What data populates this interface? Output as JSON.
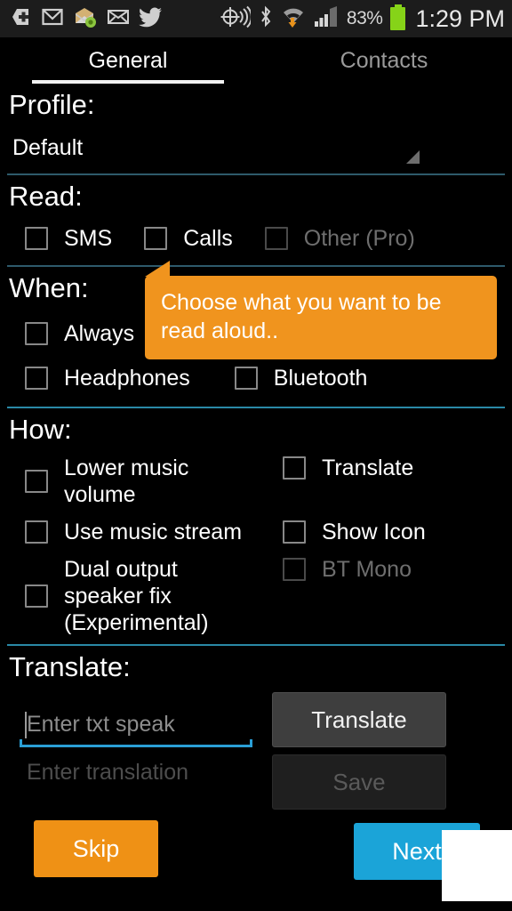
{
  "status_bar": {
    "notification_icons": [
      "add-plus-icon",
      "gmail-icon",
      "mail-badge-icon",
      "envelope-icon",
      "twitter-icon"
    ],
    "system_icons": [
      "location-gps-icon",
      "bluetooth-icon",
      "wifi-download-icon",
      "signal-bars-icon"
    ],
    "battery_percent": "83%",
    "battery_icon": "battery-full-icon",
    "clock": "1:29 PM"
  },
  "tabs": [
    {
      "label": "General",
      "active": true
    },
    {
      "label": "Contacts",
      "active": false
    }
  ],
  "sections": {
    "profile": {
      "title": "Profile:",
      "selected": "Default"
    },
    "read": {
      "title": "Read:",
      "items": [
        {
          "label": "SMS",
          "checked": false,
          "disabled": false
        },
        {
          "label": "Calls",
          "checked": false,
          "disabled": false
        },
        {
          "label": "Other (Pro)",
          "checked": false,
          "disabled": true
        }
      ]
    },
    "when": {
      "title": "When:",
      "items": [
        {
          "label": "Always",
          "checked": false,
          "disabled": false
        },
        {
          "label": "Headphones",
          "checked": false,
          "disabled": false
        },
        {
          "label": "Bluetooth",
          "checked": false,
          "disabled": false
        }
      ]
    },
    "how": {
      "title": "How:",
      "items": [
        {
          "label": "Lower music volume",
          "checked": false,
          "disabled": false
        },
        {
          "label": "Translate",
          "checked": false,
          "disabled": false
        },
        {
          "label": "Use music stream",
          "checked": false,
          "disabled": false
        },
        {
          "label": "Show Icon",
          "checked": false,
          "disabled": false
        },
        {
          "label": "Dual output speaker fix (Experimental)",
          "checked": false,
          "disabled": false
        },
        {
          "label": "BT Mono",
          "checked": false,
          "disabled": true
        }
      ]
    },
    "translate": {
      "title": "Translate:",
      "input_placeholder": "Enter txt speak",
      "input_value": "",
      "translate_button": "Translate",
      "translation_placeholder": "Enter translation",
      "translation_value": "",
      "save_button": "Save"
    }
  },
  "tooltip": {
    "text": "Choose what you want to be read aloud.."
  },
  "wizard": {
    "skip_label": "Skip",
    "next_label": "Next"
  },
  "colors": {
    "accent_orange": "#ef9115",
    "accent_blue": "#1ba4d8",
    "divider": "#2e5a6b",
    "divider_bright": "#2a89a6",
    "battery_green": "#86d318"
  }
}
